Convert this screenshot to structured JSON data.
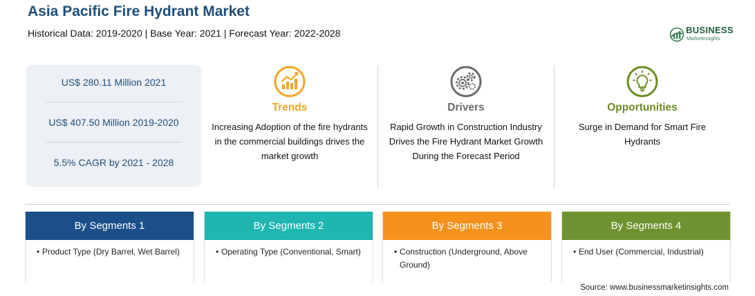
{
  "header": {
    "title": "Asia Pacific Fire Hydrant Market",
    "subtitle": "Historical Data: 2019-2020 | Base Year: 2021 | Forecast Year: 2022-2028"
  },
  "logo": {
    "name": "BUSINESS",
    "tagline": "MarketInsights"
  },
  "stats": [
    "US$ 280.11 Million 2021",
    "US$ 407.50 Million 2019-2020",
    "5.5% CAGR by 2021 - 2028"
  ],
  "columns": {
    "trends": {
      "icon": "trend-chart-icon",
      "title": "Trends",
      "text": "Increasing Adoption of the fire hydrants in the commercial buildings drives the market growth"
    },
    "drivers": {
      "icon": "gears-icon",
      "title": "Drivers",
      "text": "Rapid Growth in Construction Industry Drives the Fire Hydrant Market Growth During the Forecast Period"
    },
    "opportunities": {
      "icon": "lightbulb-icon",
      "title": "Opportunities",
      "text": "Surge in Demand for Smart Fire Hydrants"
    }
  },
  "segments": [
    {
      "title": "By Segments 1",
      "item": "Product Type (Dry Barrel, Wet Barrel)"
    },
    {
      "title": "By Segments 2",
      "item": "Operating Type (Conventional, Smart)"
    },
    {
      "title": "By Segments 3",
      "item": "Construction (Underground, Above Ground)"
    },
    {
      "title": "By Segments 4",
      "item": "End User (Commercial, Industrial)"
    }
  ],
  "colors": {
    "title": "#1f4e79",
    "trends": "#f5a623",
    "drivers": "#6b6b6b",
    "opportunities": "#6b8e23",
    "segment_1": "#1b4f8a",
    "segment_2": "#1fb5b0",
    "segment_3": "#f5921e",
    "segment_4": "#6f9230"
  },
  "source": "Source: www.businessmarketinsights.com"
}
